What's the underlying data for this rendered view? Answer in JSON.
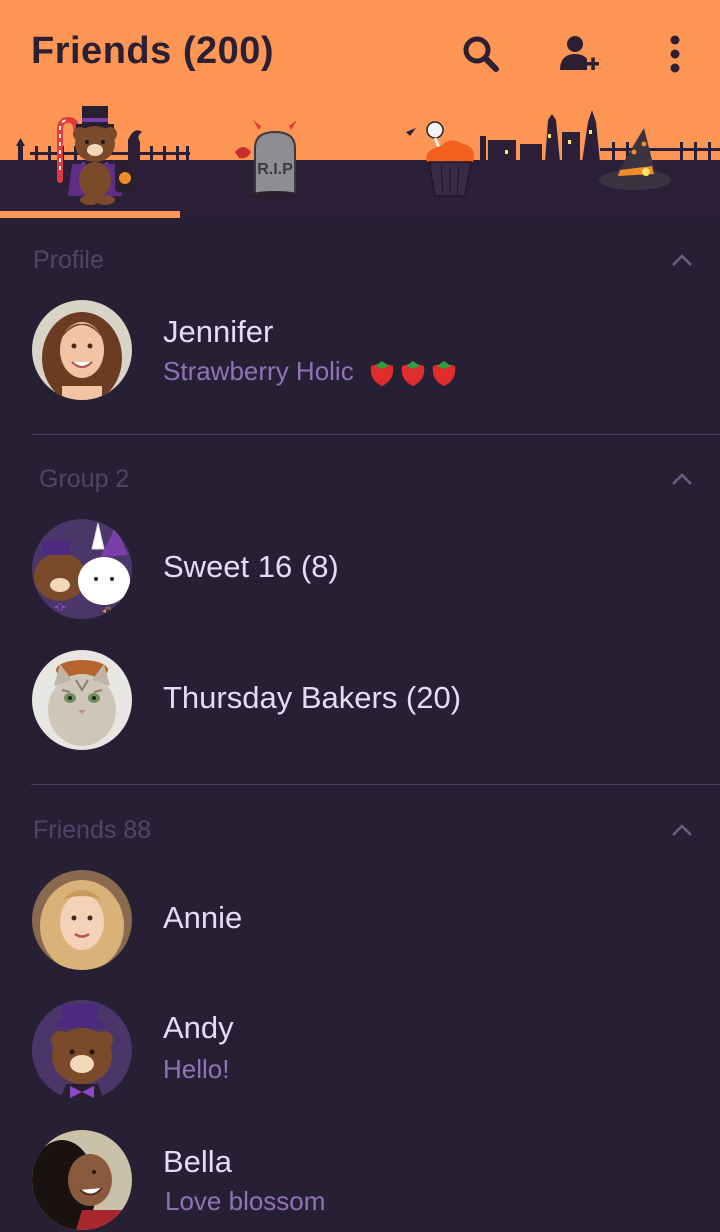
{
  "header": {
    "title": "Friends",
    "count": "(200)",
    "icons": {
      "search": "search-icon",
      "add_friend": "add-friend-icon",
      "more": "more-vertical-icon"
    },
    "theme_tabs": [
      "brown-bear-tab",
      "rip-tombstone-tab",
      "cupcake-tab",
      "witch-hat-tab"
    ],
    "colors": {
      "header_bg": "#FD9655",
      "skyline": "#2C2038",
      "indicator": "#FD9655"
    }
  },
  "sections": {
    "profile": {
      "title": "Profile",
      "items": [
        {
          "name": "Jennifer",
          "status": "Strawberry Holic 🍓🍓🍓",
          "status_text": "Strawberry Holic"
        }
      ]
    },
    "group": {
      "title": "Group 2",
      "items": [
        {
          "name": "Sweet 16 (8)"
        },
        {
          "name": "Thursday Bakers (20)"
        }
      ]
    },
    "friends": {
      "title": "Friends 88",
      "items": [
        {
          "name": "Annie"
        },
        {
          "name": "Andy",
          "status": "Hello!"
        },
        {
          "name": "Bella",
          "status": "Love blossom"
        }
      ]
    }
  },
  "colors": {
    "background": "#272034",
    "name_text": "#E8D9F5",
    "status_text": "#8F73B6",
    "section_text": "#524466"
  }
}
